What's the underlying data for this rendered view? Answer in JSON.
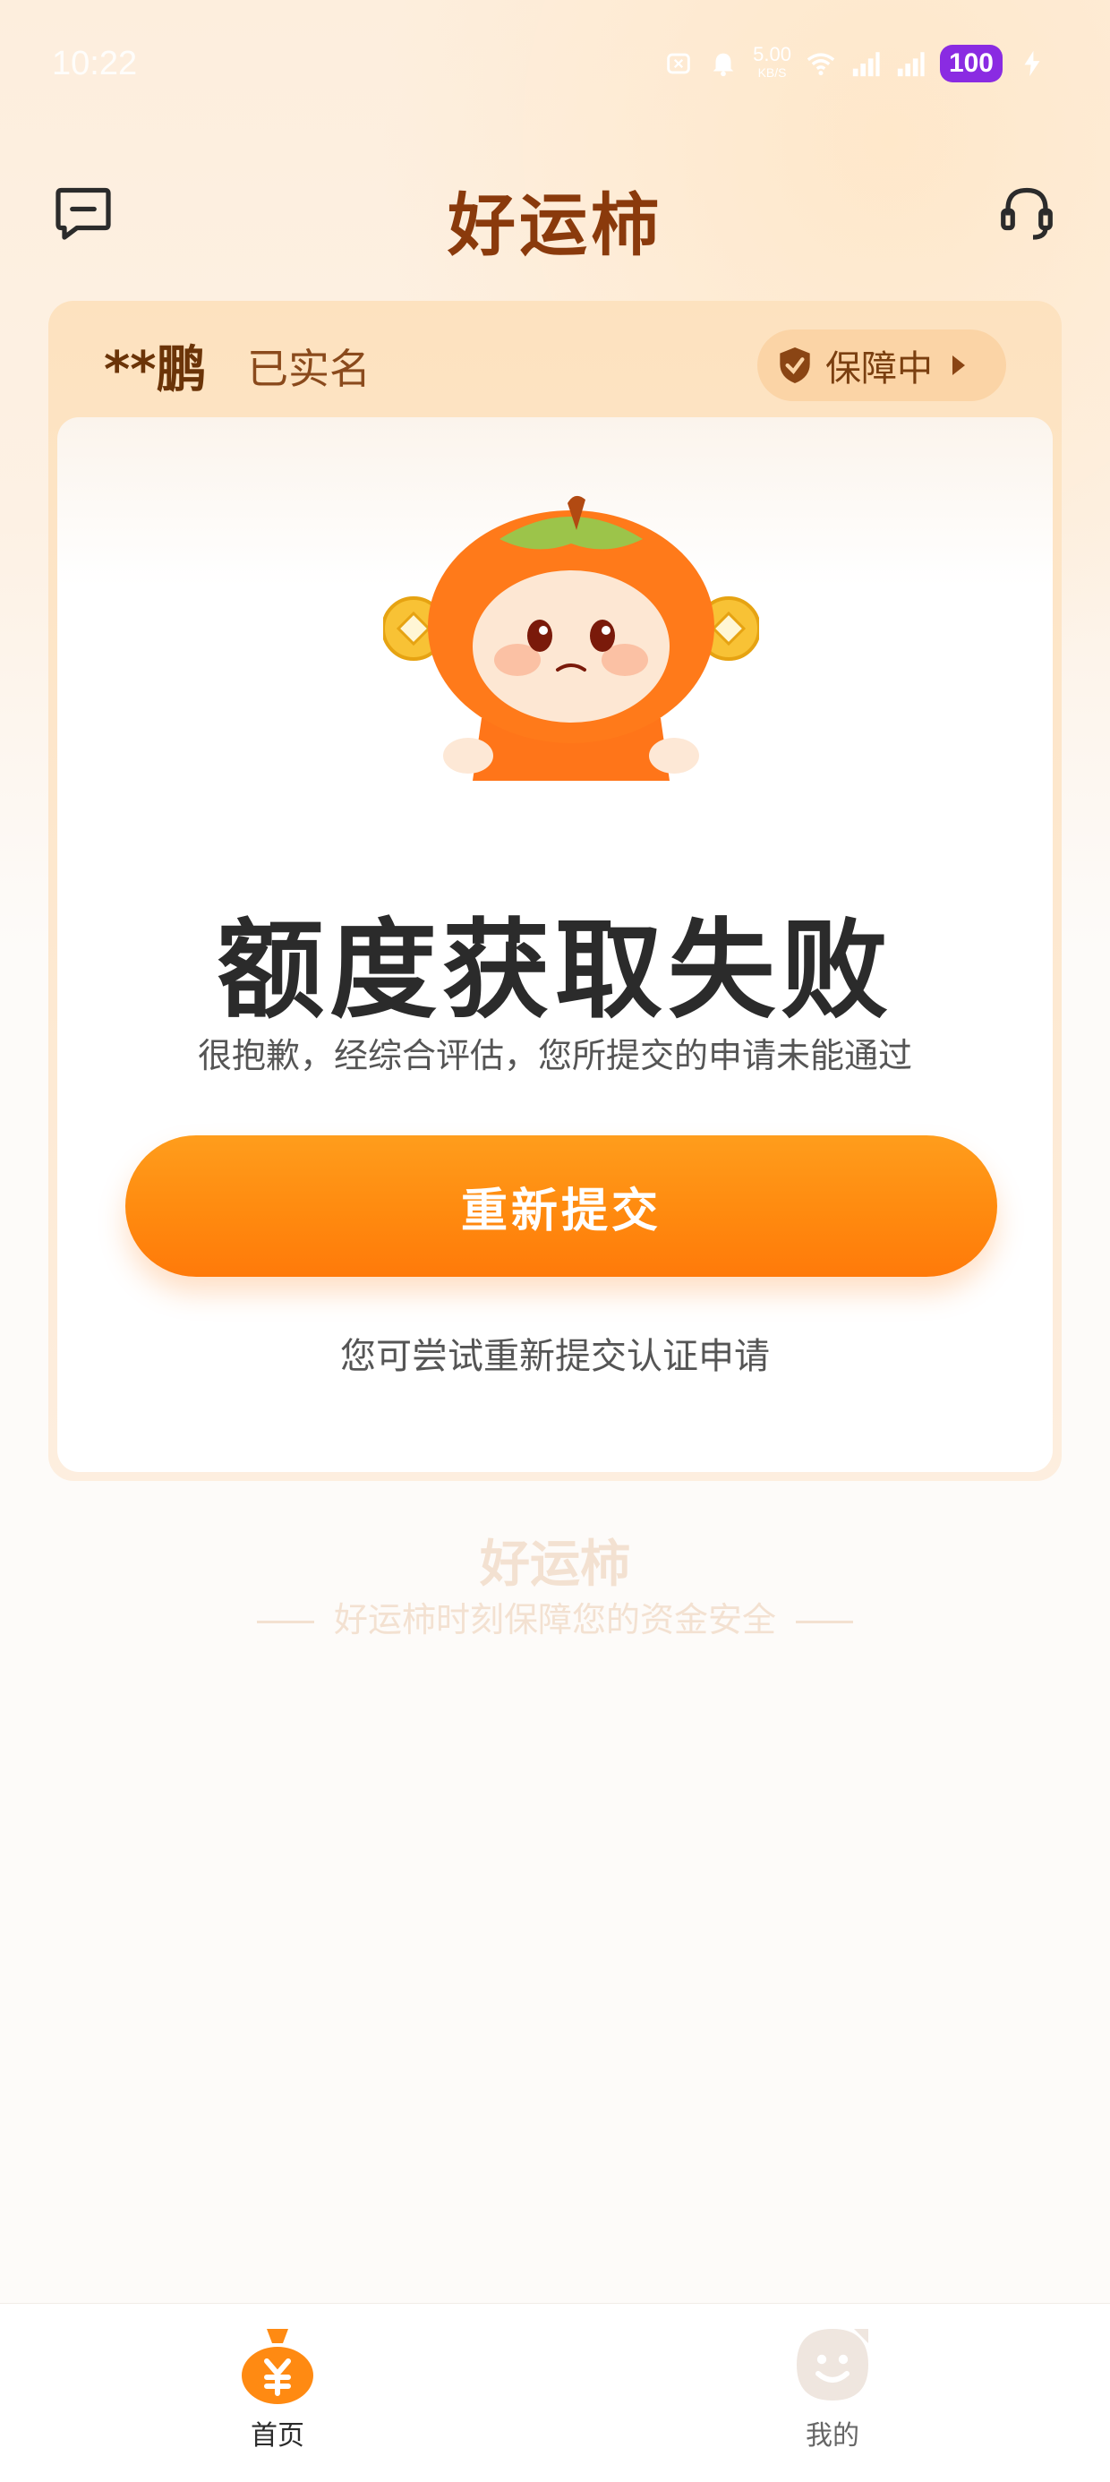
{
  "status_bar": {
    "time": "10:22",
    "speed_value": "5.00",
    "speed_unit": "KB/S",
    "battery": "100"
  },
  "header": {
    "title": "好运柿",
    "message_icon": "message-icon",
    "service_icon": "headset-icon"
  },
  "user": {
    "name": "**鹏",
    "verified": "已实名",
    "protection_label": "保障中"
  },
  "result": {
    "title": "额度获取失败",
    "description": "很抱歉，经综合评估，您所提交的申请未能通过",
    "button_label": "重新提交",
    "hint": "您可尝试重新提交认证申请"
  },
  "watermark": {
    "brand": "好运柿",
    "slogan": "好运柿时刻保障您的资金安全"
  },
  "tabs": [
    {
      "label": "首页",
      "icon": "money-bag-icon",
      "active": true
    },
    {
      "label": "我的",
      "icon": "profile-face-icon",
      "active": false
    }
  ],
  "colors": {
    "brand": "#8a3a0c",
    "accent": "#ff8a0f",
    "battery": "#8a2be2"
  }
}
